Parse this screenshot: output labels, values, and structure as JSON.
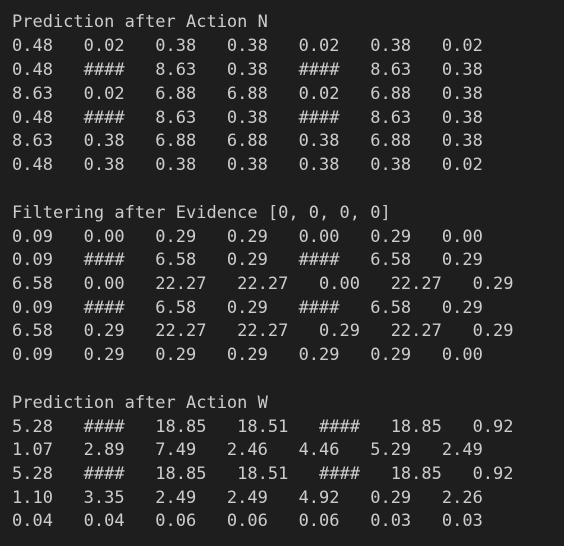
{
  "terminal": {
    "lines": [
      "Prediction after Action N",
      "0.48   0.02   0.38   0.38   0.02   0.38   0.02",
      "0.48   ####   8.63   0.38   ####   8.63   0.38",
      "8.63   0.02   6.88   6.88   0.02   6.88   0.38",
      "0.48   ####   8.63   0.38   ####   8.63   0.38",
      "8.63   0.38   6.88   6.88   0.38   6.88   0.38",
      "0.48   0.38   0.38   0.38   0.38   0.38   0.02",
      "",
      "Filtering after Evidence [0, 0, 0, 0]",
      "0.09   0.00   0.29   0.29   0.00   0.29   0.00",
      "0.09   ####   6.58   0.29   ####   6.58   0.29",
      "6.58   0.00   22.27   22.27   0.00   22.27   0.29",
      "0.09   ####   6.58   0.29   ####   6.58   0.29",
      "6.58   0.29   22.27   22.27   0.29   22.27   0.29",
      "0.09   0.29   0.29   0.29   0.29   0.29   0.00",
      "",
      "Prediction after Action W",
      "5.28   ####   18.85   18.51   ####   18.85   0.92",
      "1.07   2.89   7.49   2.46   4.46   5.29   2.49",
      "5.28   ####   18.85   18.51   ####   18.85   0.92",
      "1.10   3.35   2.49   2.49   4.92   0.29   2.26",
      "0.04   0.04   0.06   0.06   0.06   0.03   0.03"
    ]
  }
}
